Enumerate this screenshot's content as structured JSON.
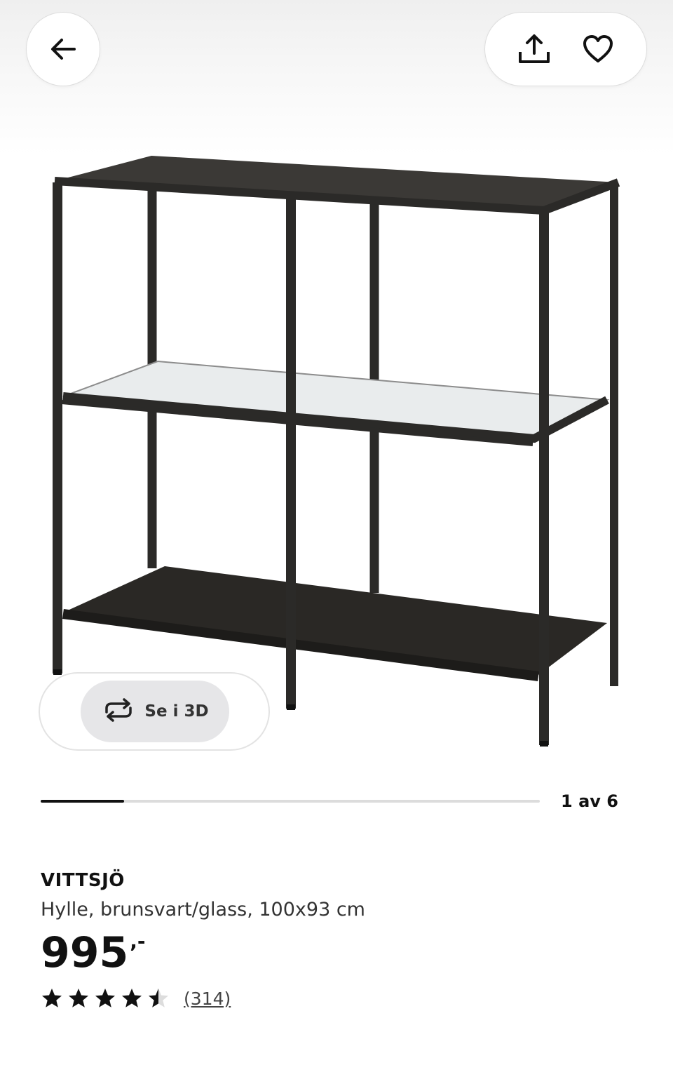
{
  "nav": {
    "back_icon": "arrow-left-icon",
    "share_icon": "share-icon",
    "favorite_icon": "heart-icon"
  },
  "gallery": {
    "view3d_label": "Se i 3D",
    "view3d_icon": "rotate-icon",
    "pager_text": "1 av 6",
    "progress_fraction": 0.1667
  },
  "product": {
    "name": "VITTSJÖ",
    "description": "Hylle, brunsvart/glass, 100x93 cm",
    "price_integer": "995",
    "price_decimal": ",-",
    "rating": 4.5,
    "rating_max": 5,
    "review_count": "(314)"
  },
  "colors": {
    "text": "#111111",
    "shelf_frame": "#2b2a28",
    "progress_fill": "#111111",
    "progress_track": "#dcdcdc",
    "chip_bg": "#e6e6e8"
  }
}
